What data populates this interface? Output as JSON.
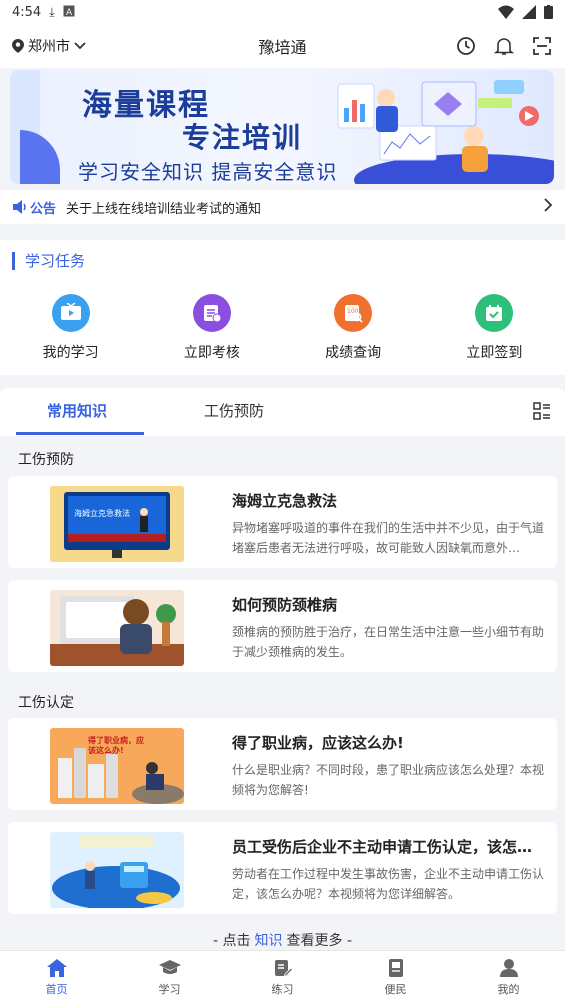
{
  "status_bar": {
    "time": "4:54"
  },
  "header": {
    "location": "郑州市",
    "title": "豫培通"
  },
  "banner": {
    "line1": "海量课程",
    "line2": "专注培训",
    "line3": "学习安全知识  提高安全意识"
  },
  "notice": {
    "tag": "公告",
    "text": "关于上线在线培训结业考试的通知"
  },
  "study_tasks": {
    "title": "学习任务",
    "items": [
      {
        "label": "我的学习",
        "icon": "tv-icon",
        "color": "#3aa0f0"
      },
      {
        "label": "立即考核",
        "icon": "exam-icon",
        "color": "#8a4fe0"
      },
      {
        "label": "成绩查询",
        "icon": "score-icon",
        "color": "#f07030"
      },
      {
        "label": "立即签到",
        "icon": "calendar-check-icon",
        "color": "#2ec07a"
      }
    ]
  },
  "knowledge_tabs": {
    "tabs": [
      {
        "label": "常用知识"
      },
      {
        "label": "工伤预防"
      }
    ]
  },
  "sections": [
    {
      "label": "工伤预防",
      "cards": [
        {
          "title": "海姆立克急救法",
          "desc": "异物堵塞呼吸道的事件在我们的生活中并不少见，由于气道堵塞后患者无法进行呼吸，故可能致人因缺氧而意外…"
        },
        {
          "title": "如何预防颈椎病",
          "desc": "颈椎病的预防胜于治疗，在日常生活中注意一些小细节有助于减少颈椎病的发生。"
        }
      ]
    },
    {
      "label": "工伤认定",
      "cards": [
        {
          "title": "得了职业病，应该这么办!",
          "desc": "什么是职业病？不同时段，患了职业病应该怎么处理？本视频将为您解答!"
        },
        {
          "title": "员工受伤后企业不主动申请工伤认定，该怎么办…",
          "desc": "劳动者在工作过程中发生事故伤害，企业不主动申请工伤认定，该怎么办呢？本视频将为您详细解答。"
        }
      ]
    }
  ],
  "thumbs": {
    "t1_title": "海姆立克急救法",
    "t3_text": "得了职业病，应该这么办!"
  },
  "more": {
    "prefix": "-  点击",
    "link": "知识",
    "suffix": "查看更多  -"
  },
  "tabbar": {
    "items": [
      {
        "label": "首页",
        "icon": "home-icon"
      },
      {
        "label": "学习",
        "icon": "graduation-cap-icon"
      },
      {
        "label": "练习",
        "icon": "edit-icon"
      },
      {
        "label": "便民",
        "icon": "book-icon"
      },
      {
        "label": "我的",
        "icon": "user-icon"
      }
    ],
    "active_color": "#3b63e0"
  }
}
